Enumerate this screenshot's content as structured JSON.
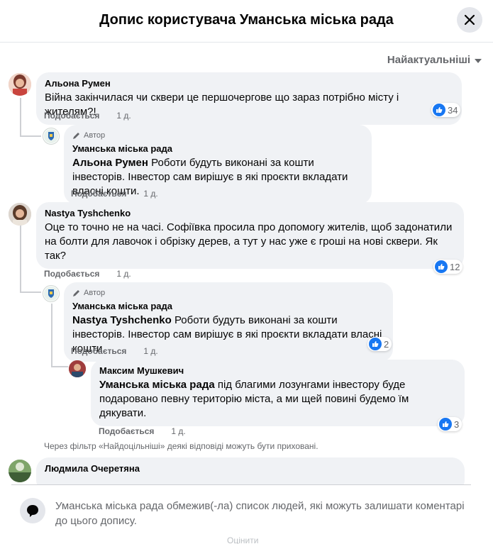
{
  "dialog": {
    "title": "Допис користувача Уманська міська рада"
  },
  "sort": {
    "label": "Найактуальніші"
  },
  "author_badge": "Автор",
  "action_like": "Подобається",
  "comments": [
    {
      "author": "Альона Румен",
      "text": "Війна закінчилася чи сквери це першочергове що зараз потрібно місту і жителям?!",
      "time": "1 д.",
      "reactions": "34"
    },
    {
      "author": "Уманська міська рада",
      "mention": "Альона Румен",
      "text": " Роботи будуть виконані за кошти інвесторів. Інвестор сам вирішує в які проєкти вкладати власні кошти.",
      "time": "1 д."
    },
    {
      "author": "Nastya Tyshchenko",
      "text": "Оце то точно не на часі. Софіївка просила про допомогу жителів, щоб задонатили на болти для лавочок і обрізку дерев, а тут у нас уже є гроші на нові сквери. Як так?",
      "time": "1 д.",
      "reactions": "12"
    },
    {
      "author": "Уманська міська рада",
      "mention": "Nastya Tyshchenko",
      "text": " Роботи будуть виконані за кошти інвесторів. Інвестор сам вирішує в які проєкти вкладати власні кошти.",
      "time": "1 д.",
      "reactions": "2"
    },
    {
      "author": "Максим Мушкевич",
      "mention": "Уманська міська рада",
      "text": " під благими лозунгами інвестору буде подаровано певну територію міста, а ми щей повині будемо їм дякувати.",
      "time": "1 д.",
      "reactions": "3"
    },
    {
      "author": "Людмила Очеретяна"
    }
  ],
  "filter_note": "Через фільтр «Найдоцільніші» деякі відповіді можуть бути приховані.",
  "footer": {
    "notice": "Уманська міська рада обмежив(-ла) список людей, які можуть залишати коментарі до цього допису.",
    "ghost_text": "Оцінити"
  },
  "colors": {
    "accent": "#1877f2",
    "bubble": "#f0f2f5",
    "secondary_text": "#65676b"
  }
}
